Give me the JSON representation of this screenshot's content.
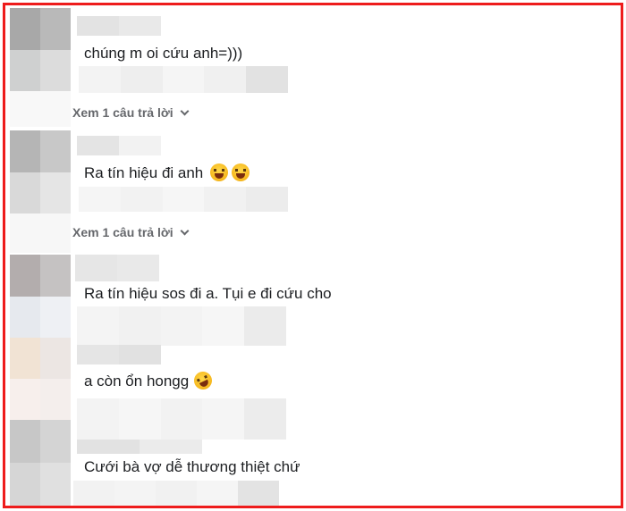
{
  "comments": [
    {
      "text": "chúng m oi cứu anh=)))",
      "emoji": []
    },
    {
      "text": "Ra tín hiệu đi anh",
      "emoji": [
        "face-with-tears-of-joy-icon",
        "face-with-tears-of-joy-icon"
      ]
    },
    {
      "text": "Ra tín hiệu sos đi a. Tụi e đi cứu cho",
      "emoji": []
    },
    {
      "text": "a còn ổn hongg",
      "emoji": [
        "rolling-on-floor-laughing-icon"
      ]
    },
    {
      "text": "Cưới bà vợ dễ thương thiệt chứ",
      "emoji": []
    }
  ],
  "replies": [
    {
      "label": "Xem 1 câu trả lời"
    },
    {
      "label": "Xem 1 câu trả lời"
    }
  ],
  "colors": {
    "border": "#ee1c1c",
    "text": "#1c1e21",
    "secondary": "#65676b"
  }
}
